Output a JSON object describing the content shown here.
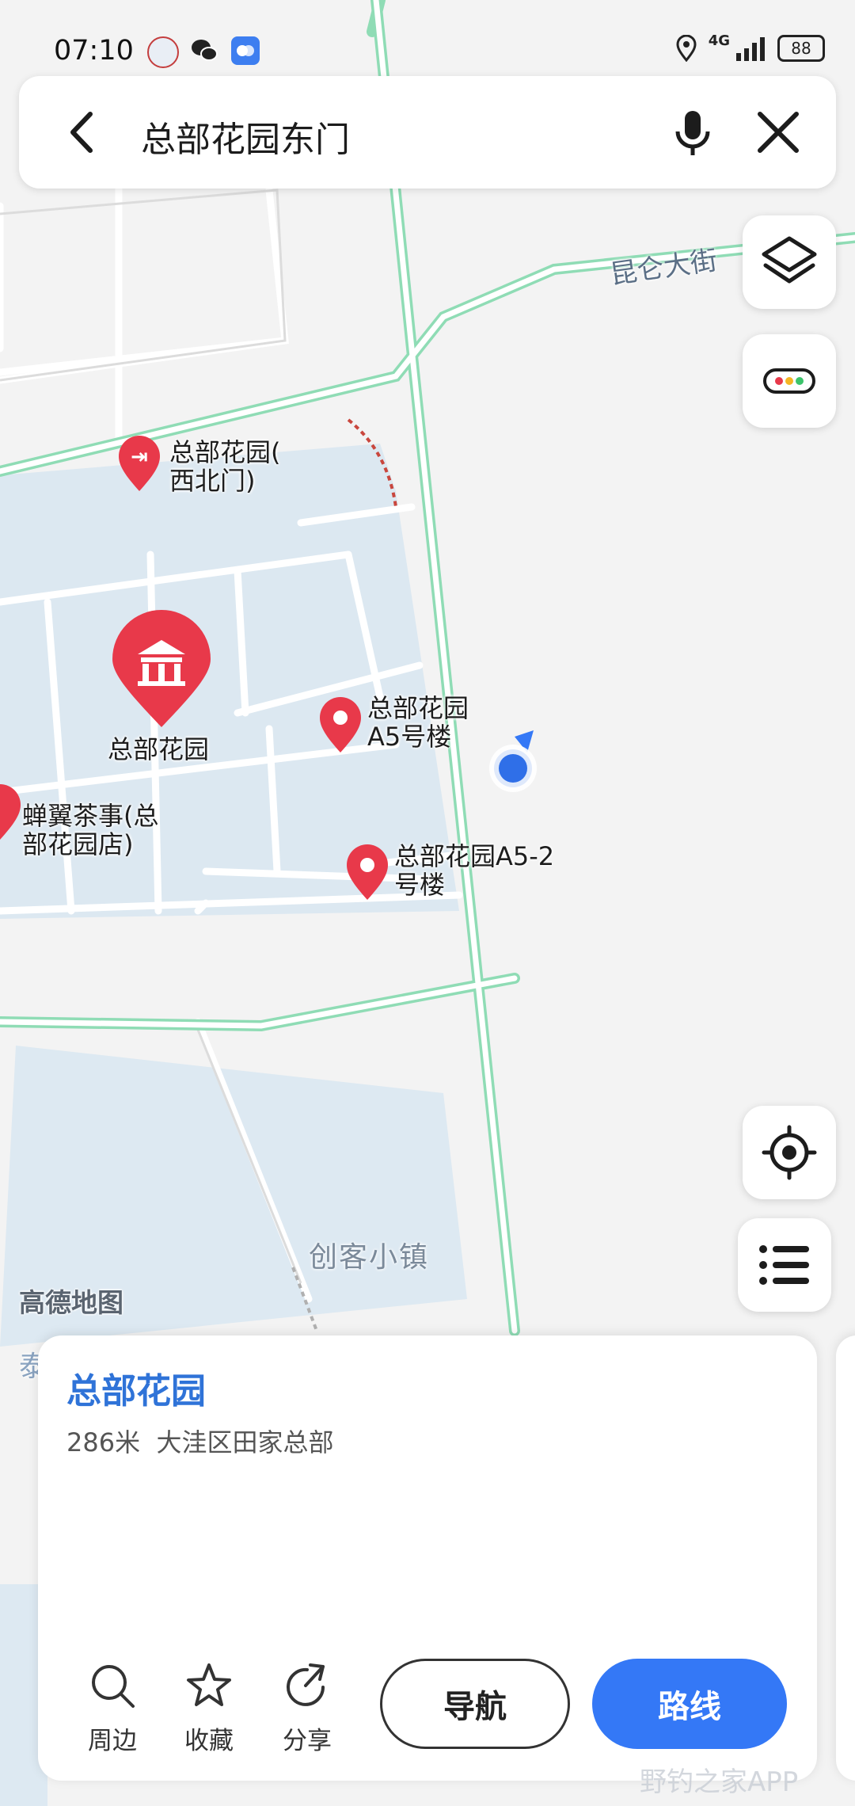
{
  "status": {
    "time": "07:10",
    "network": "4G",
    "battery": "88"
  },
  "search": {
    "query": "总部花园东门"
  },
  "map": {
    "road_label": "昆仑大街",
    "area_label": "创客小镇",
    "map_brand": "高德地图",
    "partial_label": "泰",
    "pois": {
      "northwest_gate_line1": "总部花园(",
      "northwest_gate_line2": "西北门)",
      "main": "总部花园",
      "a5_line1": "总部花园",
      "a5_line2": "A5号楼",
      "tea_line1": "蝉翼茶事(总",
      "tea_line2": "部花园店)",
      "a52_line1": "总部花园A5-2",
      "a52_line2": "号楼"
    }
  },
  "card": {
    "title": "总部花园",
    "distance": "286米",
    "address": "大洼区田家总部",
    "actions": {
      "nearby": "周边",
      "favorite": "收藏",
      "share": "分享"
    },
    "navigate_label": "导航",
    "route_label": "路线"
  },
  "watermark": "野钓之家APP",
  "colors": {
    "accent": "#3478f6",
    "title_blue": "#2f73d8",
    "poi_red": "#e8394a",
    "road_green": "#8fdcb5",
    "block_blue": "#dde9f2"
  }
}
